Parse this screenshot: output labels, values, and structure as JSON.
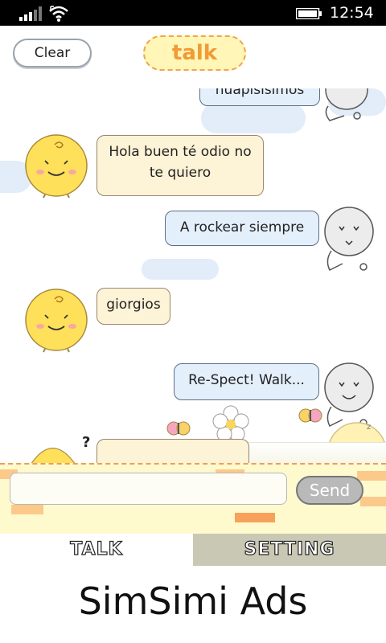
{
  "status": {
    "time": "12:54"
  },
  "header": {
    "clear_label": "Clear",
    "title": "talk"
  },
  "chat": {
    "messages": [
      {
        "sender": "user",
        "text": "nuapisisimos"
      },
      {
        "sender": "simsimi",
        "text": "Hola buen té odio no te quiero"
      },
      {
        "sender": "user",
        "text": "A rockear siempre"
      },
      {
        "sender": "simsimi",
        "text": "giorgios"
      },
      {
        "sender": "user",
        "text": "Re-Spect! Walk..."
      }
    ]
  },
  "input": {
    "value": "",
    "placeholder": "",
    "send_label": "Send"
  },
  "tabs": [
    {
      "label": "TALK"
    },
    {
      "label": "SETTING"
    }
  ],
  "ads": {
    "text": "SimSimi Ads"
  },
  "colors": {
    "status_bar": "#000000",
    "sim_bubble": "#fdf3d6",
    "user_bubble": "#e4effc",
    "title_orange": "#f29a35",
    "input_bar": "#fff9ce",
    "setting_tab": "#c8c8b4"
  },
  "icons": [
    "signal-icon",
    "wifi-icon",
    "battery-icon",
    "simsimi-avatar",
    "user-avatar",
    "flower-icon",
    "butterfly-icon"
  ]
}
